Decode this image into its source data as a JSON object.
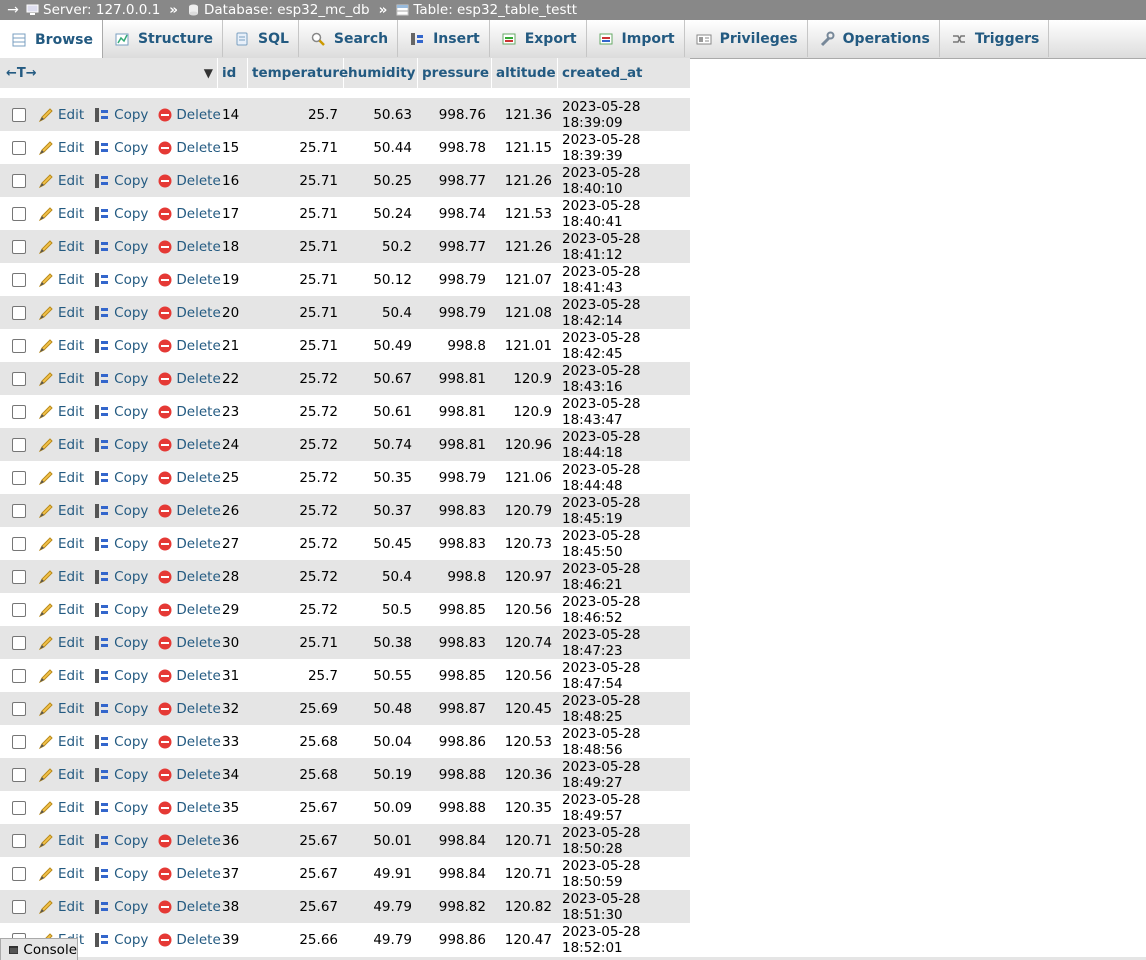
{
  "breadcrumb": {
    "server": "Server: 127.0.0.1",
    "database": "Database: esp32_mc_db",
    "table": "Table: esp32_table_testt",
    "separator": "»",
    "back_arrow": "→"
  },
  "tabs": [
    {
      "label": "Browse",
      "icon": "browse-icon",
      "active": true
    },
    {
      "label": "Structure",
      "icon": "structure-icon"
    },
    {
      "label": "SQL",
      "icon": "sql-icon"
    },
    {
      "label": "Search",
      "icon": "search-icon"
    },
    {
      "label": "Insert",
      "icon": "insert-icon"
    },
    {
      "label": "Export",
      "icon": "export-icon"
    },
    {
      "label": "Import",
      "icon": "import-icon"
    },
    {
      "label": "Privileges",
      "icon": "privileges-icon"
    },
    {
      "label": "Operations",
      "icon": "wrench-icon"
    },
    {
      "label": "Triggers",
      "icon": "triggers-icon"
    }
  ],
  "grid": {
    "column_toggle": "←T→",
    "columns": [
      "id",
      "temperature",
      "humidity",
      "pressure",
      "altitude",
      "created_at"
    ],
    "actions": {
      "edit": "Edit",
      "copy": "Copy",
      "delete": "Delete"
    },
    "rows": [
      [
        "14",
        "25.7",
        "50.63",
        "998.76",
        "121.36",
        "2023-05-28 18:39:09"
      ],
      [
        "15",
        "25.71",
        "50.44",
        "998.78",
        "121.15",
        "2023-05-28 18:39:39"
      ],
      [
        "16",
        "25.71",
        "50.25",
        "998.77",
        "121.26",
        "2023-05-28 18:40:10"
      ],
      [
        "17",
        "25.71",
        "50.24",
        "998.74",
        "121.53",
        "2023-05-28 18:40:41"
      ],
      [
        "18",
        "25.71",
        "50.2",
        "998.77",
        "121.26",
        "2023-05-28 18:41:12"
      ],
      [
        "19",
        "25.71",
        "50.12",
        "998.79",
        "121.07",
        "2023-05-28 18:41:43"
      ],
      [
        "20",
        "25.71",
        "50.4",
        "998.79",
        "121.08",
        "2023-05-28 18:42:14"
      ],
      [
        "21",
        "25.71",
        "50.49",
        "998.8",
        "121.01",
        "2023-05-28 18:42:45"
      ],
      [
        "22",
        "25.72",
        "50.67",
        "998.81",
        "120.9",
        "2023-05-28 18:43:16"
      ],
      [
        "23",
        "25.72",
        "50.61",
        "998.81",
        "120.9",
        "2023-05-28 18:43:47"
      ],
      [
        "24",
        "25.72",
        "50.74",
        "998.81",
        "120.96",
        "2023-05-28 18:44:18"
      ],
      [
        "25",
        "25.72",
        "50.35",
        "998.79",
        "121.06",
        "2023-05-28 18:44:48"
      ],
      [
        "26",
        "25.72",
        "50.37",
        "998.83",
        "120.79",
        "2023-05-28 18:45:19"
      ],
      [
        "27",
        "25.72",
        "50.45",
        "998.83",
        "120.73",
        "2023-05-28 18:45:50"
      ],
      [
        "28",
        "25.72",
        "50.4",
        "998.8",
        "120.97",
        "2023-05-28 18:46:21"
      ],
      [
        "29",
        "25.72",
        "50.5",
        "998.85",
        "120.56",
        "2023-05-28 18:46:52"
      ],
      [
        "30",
        "25.71",
        "50.38",
        "998.83",
        "120.74",
        "2023-05-28 18:47:23"
      ],
      [
        "31",
        "25.7",
        "50.55",
        "998.85",
        "120.56",
        "2023-05-28 18:47:54"
      ],
      [
        "32",
        "25.69",
        "50.48",
        "998.87",
        "120.45",
        "2023-05-28 18:48:25"
      ],
      [
        "33",
        "25.68",
        "50.04",
        "998.86",
        "120.53",
        "2023-05-28 18:48:56"
      ],
      [
        "34",
        "25.68",
        "50.19",
        "998.88",
        "120.36",
        "2023-05-28 18:49:27"
      ],
      [
        "35",
        "25.67",
        "50.09",
        "998.88",
        "120.35",
        "2023-05-28 18:49:57"
      ],
      [
        "36",
        "25.67",
        "50.01",
        "998.84",
        "120.71",
        "2023-05-28 18:50:28"
      ],
      [
        "37",
        "25.67",
        "49.91",
        "998.84",
        "120.71",
        "2023-05-28 18:50:59"
      ],
      [
        "38",
        "25.67",
        "49.79",
        "998.82",
        "120.82",
        "2023-05-28 18:51:30"
      ],
      [
        "39",
        "25.66",
        "49.79",
        "998.86",
        "120.47",
        "2023-05-28 18:52:01"
      ]
    ]
  },
  "console": {
    "label": "Console"
  },
  "colors": {
    "link": "#235a81",
    "breadcrumb_bg": "#888888",
    "row_alt": "#e5e5e5"
  }
}
